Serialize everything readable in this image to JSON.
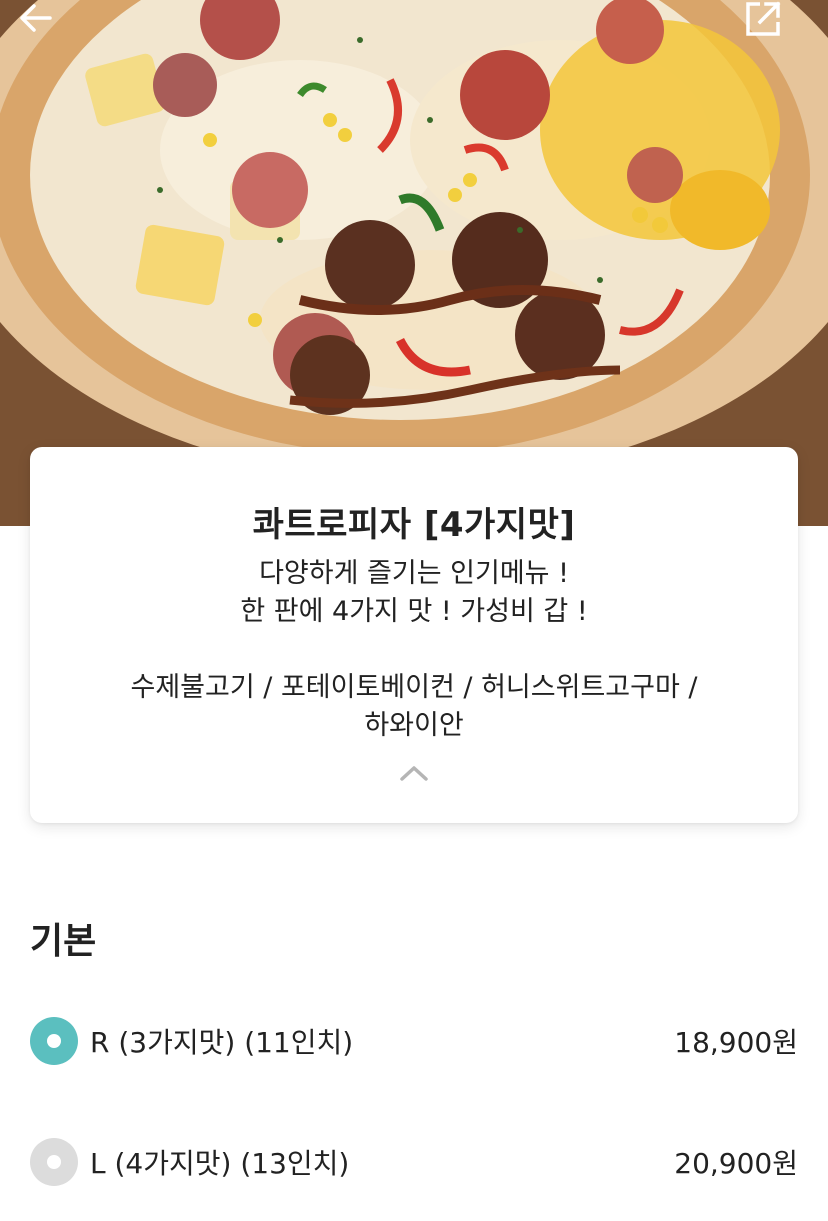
{
  "header": {
    "back_icon": "arrow-left-icon",
    "share_icon": "external-link-icon"
  },
  "product": {
    "title": "콰트로피자 [4가지맛]",
    "description_lines": [
      "다양하게 즐기는 인기메뉴 !",
      "한 판에 4가지 맛 !  가성비 갑 !"
    ],
    "flavors_lines": [
      "수제불고기 / 포테이토베이컨 / 허니스위트고구마 /",
      "하와이안"
    ],
    "collapse_icon": "chevron-up-icon"
  },
  "options_section": {
    "title": "기본",
    "options": [
      {
        "label": "R (3가지맛) (11인치)",
        "price": "18,900원",
        "selected": true
      },
      {
        "label": "L (4가지맛) (13인치)",
        "price": "20,900원",
        "selected": false
      }
    ]
  },
  "colors": {
    "radio_selected": "#5bbfbf",
    "radio_unselected": "#dcdcdc",
    "text": "#222222"
  }
}
